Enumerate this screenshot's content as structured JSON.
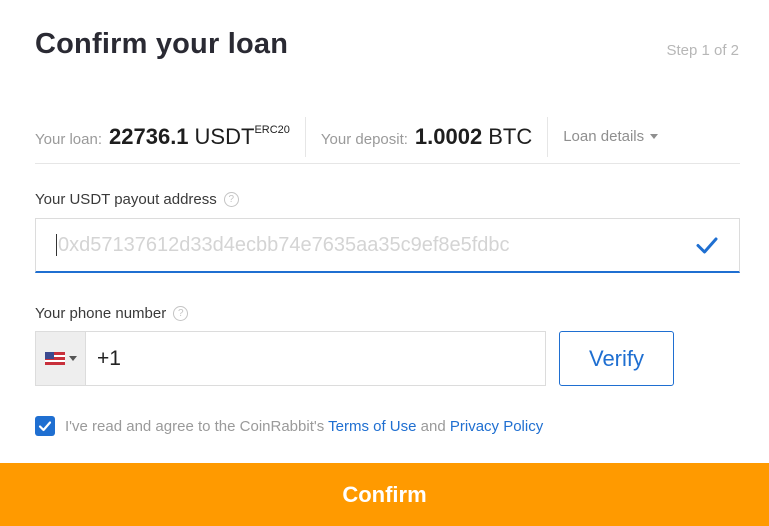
{
  "header": {
    "title": "Confirm your loan",
    "step": "Step 1 of 2"
  },
  "summary": {
    "loan_label": "Your loan:",
    "loan_amount": "22736.1",
    "loan_unit": "USDT",
    "loan_network": "ERC20",
    "deposit_label": "Your deposit:",
    "deposit_amount": "1.0002",
    "deposit_unit": "BTC",
    "details_label": "Loan details"
  },
  "address": {
    "label": "Your USDT payout address",
    "placeholder": "0xd57137612d33d4ecbb74e7635aa35c9ef8e5fdbc",
    "value": ""
  },
  "phone": {
    "label": "Your phone number",
    "country": "US",
    "value": "+1",
    "verify_label": "Verify"
  },
  "agreement": {
    "checked": true,
    "text": "I've read and agree to the CoinRabbit's ",
    "terms_label": "Terms of Use",
    "and_text": " and ",
    "privacy_label": "Privacy Policy"
  },
  "footer": {
    "confirm_label": "Confirm"
  },
  "colors": {
    "accent": "#1f6fd1",
    "confirm": "#ff9a00"
  }
}
